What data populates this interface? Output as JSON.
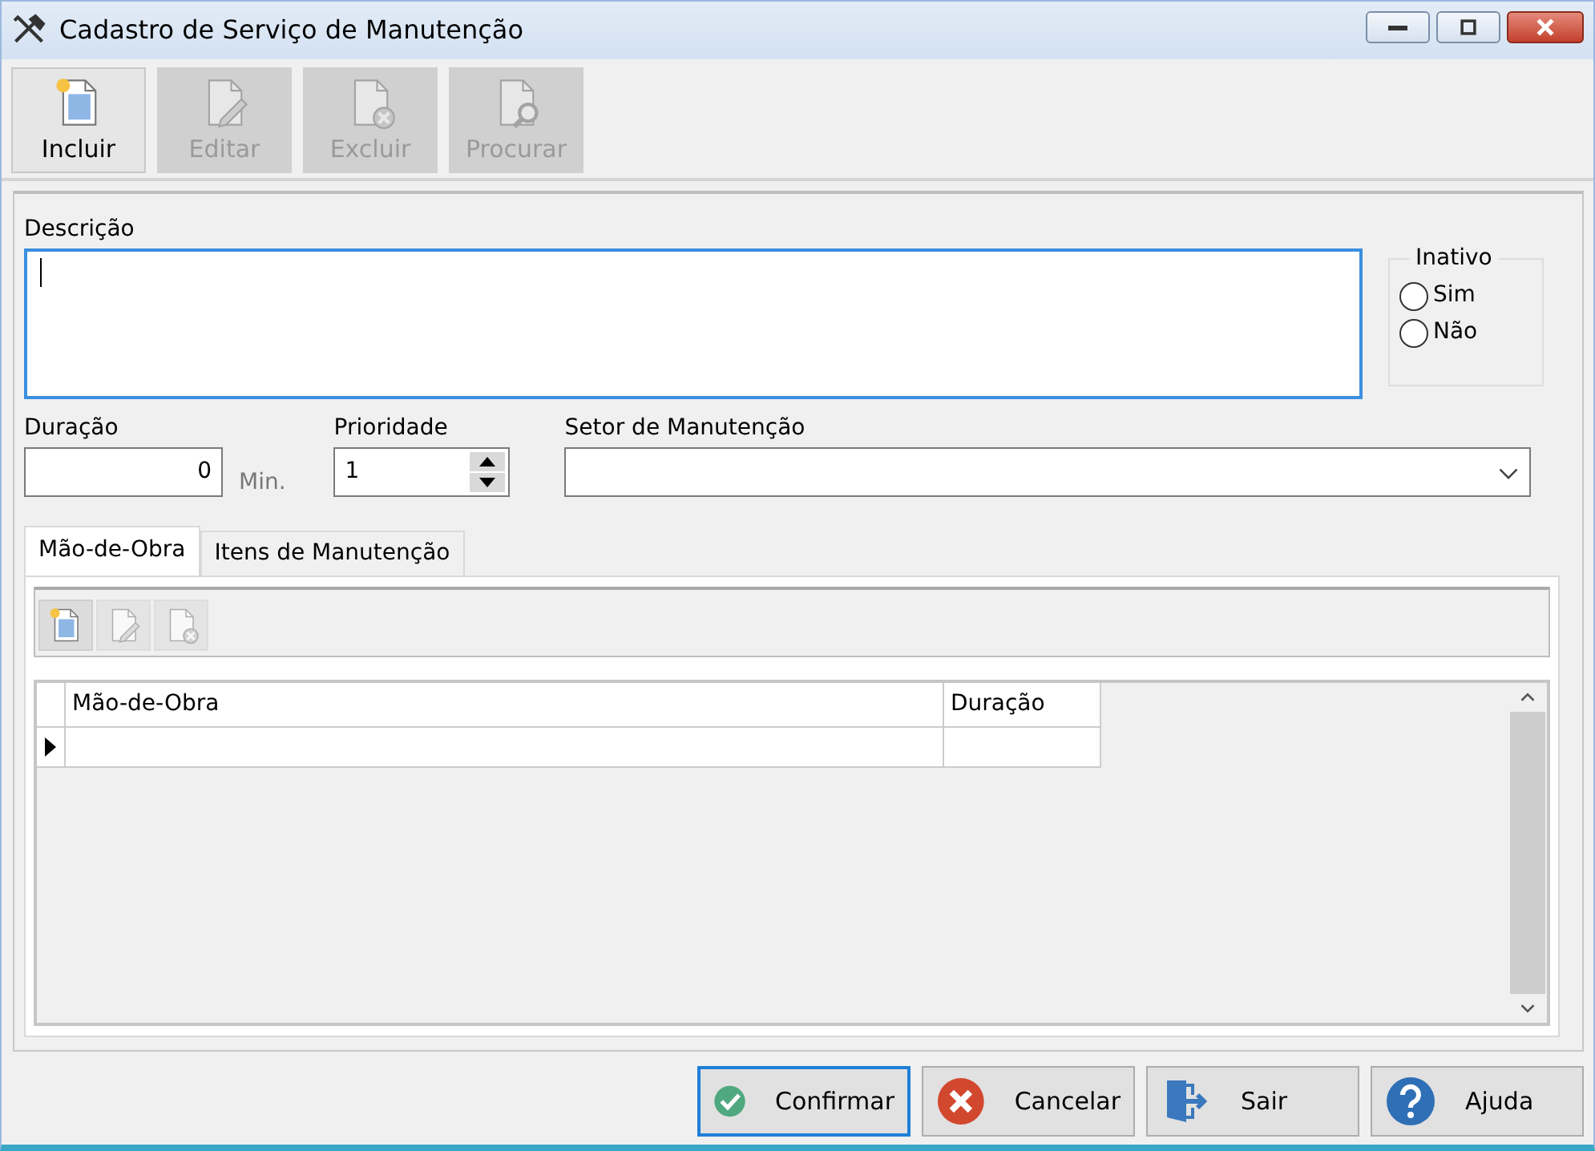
{
  "window": {
    "title": "Cadastro de Serviço de Manutenção"
  },
  "toolbar": [
    {
      "kind": "new",
      "label": "Incluir",
      "disabled": false
    },
    {
      "kind": "edit",
      "label": "Editar",
      "disabled": true
    },
    {
      "kind": "delete",
      "label": "Excluir",
      "disabled": true
    },
    {
      "kind": "search",
      "label": "Procurar",
      "disabled": true
    }
  ],
  "descricao": {
    "label": "Descrição",
    "focused": true
  },
  "inativo": {
    "legend": "Inativo",
    "options": [
      {
        "label": "Sim",
        "selected": false
      },
      {
        "label": "Não",
        "selected": false
      }
    ]
  },
  "duracao": {
    "label": "Duração",
    "value": "0",
    "unit": "Min."
  },
  "prioridade": {
    "label": "Prioridade",
    "value": "1"
  },
  "setor": {
    "label": "Setor de Manutenção"
  },
  "tabs": [
    {
      "label": "Mão-de-Obra",
      "selected": true
    },
    {
      "label": "Itens de Manutenção",
      "selected": false
    }
  ],
  "subtoolbar": [
    {
      "kind": "new",
      "disabled": false
    },
    {
      "kind": "edit",
      "disabled": true
    },
    {
      "kind": "delete",
      "disabled": true
    }
  ],
  "grid": {
    "columns": [
      "Mão-de-Obra",
      "Duração"
    ],
    "rows": [
      {
        "current": true
      }
    ]
  },
  "buttons": [
    {
      "kind": "confirm",
      "label": "Confirmar",
      "focused": true
    },
    {
      "kind": "cancel",
      "label": "Cancelar",
      "focused": false
    },
    {
      "kind": "exit",
      "label": "Sair",
      "focused": false
    },
    {
      "kind": "help",
      "label": "Ajuda",
      "focused": false
    }
  ]
}
